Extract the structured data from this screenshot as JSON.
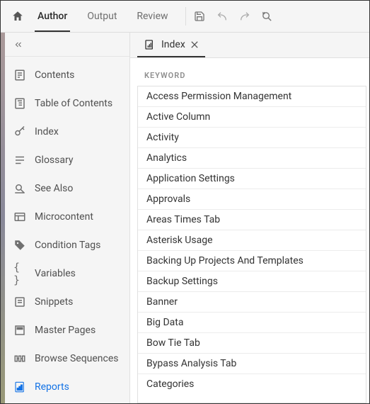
{
  "topbar": {
    "tabs": [
      {
        "label": "Author",
        "active": true
      },
      {
        "label": "Output",
        "active": false
      },
      {
        "label": "Review",
        "active": false
      }
    ]
  },
  "sidebar": {
    "items": [
      {
        "label": "Contents",
        "icon": "contents-icon"
      },
      {
        "label": "Table of Contents",
        "icon": "toc-icon"
      },
      {
        "label": "Index",
        "icon": "key-icon"
      },
      {
        "label": "Glossary",
        "icon": "glossary-icon"
      },
      {
        "label": "See Also",
        "icon": "seealso-icon"
      },
      {
        "label": "Microcontent",
        "icon": "microcontent-icon"
      },
      {
        "label": "Condition Tags",
        "icon": "tag-icon"
      },
      {
        "label": "Variables",
        "icon": "braces-icon"
      },
      {
        "label": "Snippets",
        "icon": "snippets-icon"
      },
      {
        "label": "Master Pages",
        "icon": "masterpages-icon"
      },
      {
        "label": "Browse Sequences",
        "icon": "browse-icon"
      },
      {
        "label": "Reports",
        "icon": "reports-icon",
        "active": true
      }
    ]
  },
  "main": {
    "tab_label": "Index",
    "panel_header": "KEYWORD",
    "keywords": [
      "Access Permission Management",
      "Active Column",
      "Activity",
      "Analytics",
      "Application Settings",
      "Approvals",
      "Areas Times Tab",
      "Asterisk Usage",
      "Backing Up Projects And Templates",
      "Backup Settings",
      "Banner",
      "Big Data",
      "Bow Tie Tab",
      "Bypass Analysis Tab",
      "Categories"
    ]
  }
}
